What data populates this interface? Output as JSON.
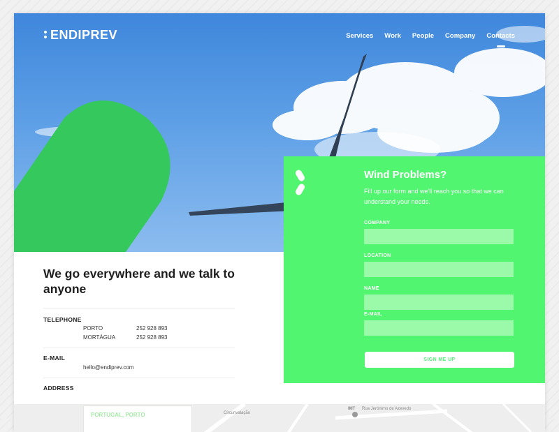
{
  "brand": {
    "name": "ENDIPREV"
  },
  "nav": {
    "items": [
      {
        "label": "Services"
      },
      {
        "label": "Work"
      },
      {
        "label": "People"
      },
      {
        "label": "Company"
      },
      {
        "label": "Contacts"
      }
    ],
    "active": "Contacts"
  },
  "contact": {
    "headline": "We go everywhere and we talk to anyone",
    "telephone_label": "TELEPHONE",
    "phones": [
      {
        "city": "PORTO",
        "number": "252 928 893"
      },
      {
        "city": "MORTÁGUA",
        "number": "252 928 893"
      }
    ],
    "email_label": "E-MAIL",
    "email": "hello@endiprev.com",
    "address_label": "ADDRESS"
  },
  "map": {
    "label": "PORTUGAL, PORTO",
    "texts": [
      "IMT",
      "Rua Jerónimo de Azevedo",
      "Circunvalação"
    ]
  },
  "form": {
    "title": "Wind Problems?",
    "subtitle": "Fill up our form and we'll reach you so that we can understand your needs.",
    "fields": [
      {
        "label": "COMPANY",
        "value": ""
      },
      {
        "label": "LOCATION",
        "value": ""
      },
      {
        "label": "NAME",
        "value": ""
      },
      {
        "label": "E-MAIL",
        "value": ""
      }
    ],
    "submit_label": "SIGN ME UP"
  },
  "colors": {
    "accent": "#52f570",
    "input_bg": "#9bf9aa",
    "shape_green": "#35c95d",
    "sky_top": "#3f87dc"
  }
}
